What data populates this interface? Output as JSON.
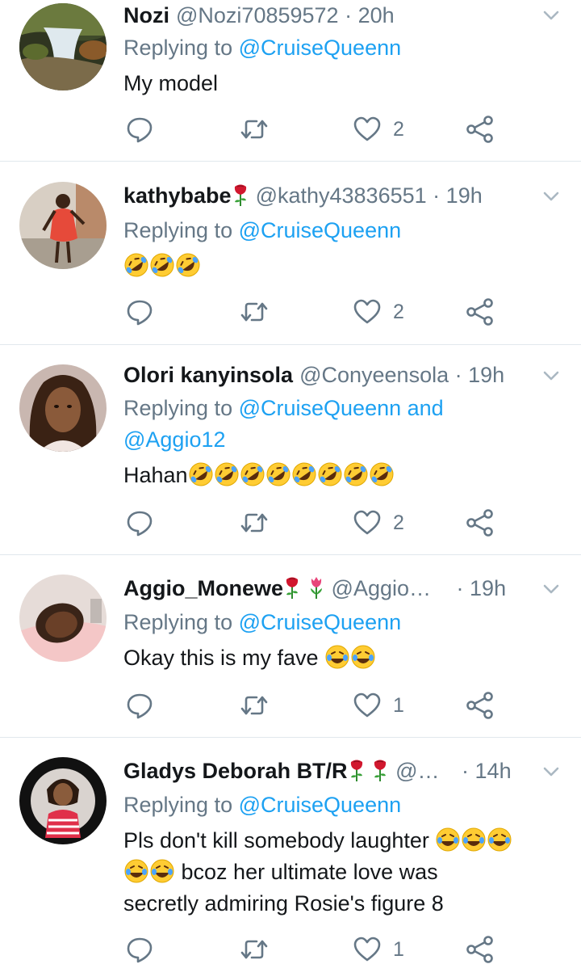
{
  "colors": {
    "link": "#1da1f2",
    "muted": "#657786",
    "text": "#14171a",
    "divider": "#e1e8ed"
  },
  "tweets": [
    {
      "name": "Nozi",
      "handle": "@Nozi70859572",
      "dot": "·",
      "time": "20h",
      "replying_prefix": "Replying to",
      "mentions": "@CruiseQueenn",
      "text": "My model",
      "likes": "2",
      "avatar_icon": "waterfall-avatar"
    },
    {
      "name": "kathybabe",
      "handle": "@kathy43836551",
      "dot": "·",
      "time": "19h",
      "replying_prefix": "Replying to",
      "mentions": "@CruiseQueenn",
      "text": "",
      "emoji_count": 3,
      "likes": "2",
      "avatar_icon": "woman-red-dress-avatar"
    },
    {
      "name": "Olori kanyinsola",
      "handle": "@Conyeensola",
      "dot": "·",
      "time": "19h",
      "replying_prefix": "Replying to",
      "mentions": "@CruiseQueenn and",
      "mentions_line2": "@Aggio12",
      "text": "Hahan",
      "emoji_count": 8,
      "likes": "2",
      "avatar_icon": "woman-braids-avatar"
    },
    {
      "name": "Aggio_Monewe",
      "handle": "@Aggio…",
      "dot": "·",
      "time": "19h",
      "replying_prefix": "Replying to",
      "mentions": "@CruiseQueenn",
      "text": "Okay this is my fave",
      "likes": "1",
      "avatar_icon": "woman-portrait-avatar"
    },
    {
      "name": "Gladys Deborah BT/R",
      "handle": "@…",
      "dot": "·",
      "time": "14h",
      "replying_prefix": "Replying to",
      "mentions": "@CruiseQueenn",
      "text_line1": "Pls don't kill somebody laughter",
      "text_line2": "bcoz her ultimate love was",
      "text_line3": "secretly admiring  Rosie's figure 8",
      "likes": "1",
      "avatar_icon": "woman-striped-avatar"
    }
  ]
}
